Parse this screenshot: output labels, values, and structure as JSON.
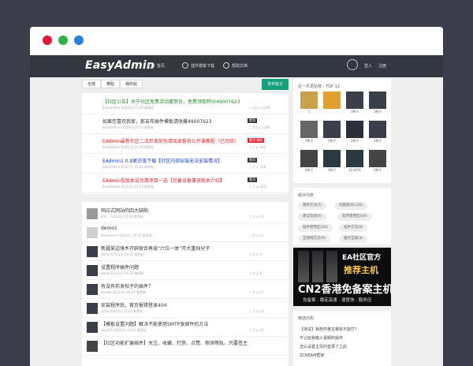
{
  "nav": {
    "logo": "EasyAdmin",
    "items": [
      {
        "label": "首页",
        "icon": "question-circle-icon"
      },
      {
        "label": "插件模板下载",
        "icon": "download-icon"
      },
      {
        "label": "帮助文档",
        "icon": "book-icon"
      }
    ],
    "login": "登入",
    "register": "注册"
  },
  "tabs": [
    "全部",
    "精贴",
    "我的帖"
  ],
  "post_button": "发布帖子",
  "pinned": [
    {
      "title": "【社区公告】关于社区免费活动邀贺份，免费领取积分49007623",
      "color": "#2e8b2e",
      "meta": "EasyAdmin    6月05日 21:26    推荐帖",
      "badge": "",
      "stats": "▢ 12   ◎ 1300"
    },
    {
      "title": "如果您喜欢我家，那友布插件模板请收藏49007623",
      "color": "#333333",
      "meta": "EasyAdmin    6月05日 22:53    推荐帖",
      "badge": "置顶",
      "stats": "▢ 12   ◎ 1300"
    },
    {
      "title": "EAdmin最新社区二次开发前先请阅读报名公开课教程（已完结）",
      "color": "#e2242a",
      "meta": "EasyAdmin    6月02日 21:46    推荐帖",
      "badge": "置顶 精帖",
      "stats": "▢ 1    ◎ 563"
    },
    {
      "title": "EAdmin1.0.8更正版下载【社区内部安装无法安装情况】",
      "color": "#1a3cdc",
      "meta": "EasyAdmin    6月27日 23:21    推荐帖",
      "badge": "置顶",
      "stats": "▢ 2    ◎ 530"
    },
    {
      "title": "EAdmin低版本设优惠项目一选【完善设备兼容版本介绍】",
      "color": "#e2242a",
      "meta": "EasyAdmin    6月27日 23:25    推荐帖",
      "badge": "置顶",
      "stats": "▢ 1    ◎ 323"
    }
  ],
  "posts": [
    {
      "title": "响应式网站的四大缺陷",
      "meta": "ERP...    6月23日 22:18    推荐帖",
      "stats": "▢ 0   ◎ 10"
    },
    {
      "title": "demo1",
      "meta": "fastadmin*    6月23日 19:35    推荐帖",
      "stats": "▢ 0   ◎ 11"
    },
    {
      "title": "新疆某边境乡开辟联合再谈“六位一体”开大重挡分子",
      "meta": "demo    6月23日 19:15    推荐帖",
      "stats": "▢ 0   ◎ 4"
    },
    {
      "title": "设置程序插件问题",
      "meta": "demo    6月23日 16:33    推荐帖",
      "stats": "▢ 0   ◎ 8"
    },
    {
      "title": "有没有前发帖子的插件？",
      "meta": "dender    6月23日 16:21    推荐帖",
      "stats": "▢ 0   ◎ 12"
    },
    {
      "title": "安装程序后，首页报错登录404",
      "meta": "1234    6月23日 15:22    推荐帖",
      "stats": "▢ 0   ◎ 10"
    },
    {
      "title": "【模板设置问题】解决不能使用SMTP发邮件的方法",
      "meta": "abc123    6月23日 14:03    推荐帖",
      "stats": "▢ 1   ◎ 21"
    },
    {
      "title": "【社区功能扩展插件】关注、收藏、打赏、点赞、侧添等轨、只要签主",
      "meta": "",
      "stats": ""
    }
  ],
  "sidebar": {
    "top_title": "近一月发贴榜 - TOP 12",
    "users": [
      "1",
      " ",
      "1鸭子",
      "1鸭子",
      "1鸭子",
      "1鸭子",
      "1鸭子",
      "1鸭子",
      "1鸭子",
      "1鸭子",
      "123456",
      "1鸭子"
    ],
    "tags_title": "版块列表",
    "tags": [
      "精英交流(5)",
      "问题版块(136)",
      "建议反馈(6)",
      "程序使用区(44)",
      "插件使用区(20)",
      "插件交流(6)",
      "互联网交流(9)",
      "服务互联(4)"
    ],
    "ad": {
      "line1": "EA社区官方",
      "line2": "推荐主机",
      "line3": "CN2香港免备案主机",
      "line4": "免备案 · 稳定高速 · 速度快 · 服务佳"
    },
    "notice_title": "精选内购",
    "notices": [
      "【测试】我想你重在哪些不能打？",
      "不让给我输入视频的操作",
      "怎么设置主页的登录了之后",
      "ZCREAM框架"
    ]
  },
  "colors": {
    "navbar": "#33373f",
    "accent": "#13a07a",
    "background": "#3b3d4a"
  }
}
